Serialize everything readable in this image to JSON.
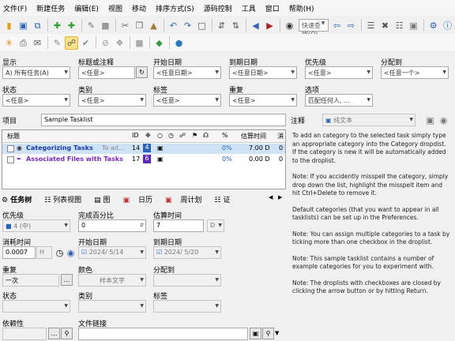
{
  "menu": [
    "文件(F)",
    "新建任务",
    "编辑(E)",
    "视图",
    "移动",
    "排序方式(S)",
    "源码控制",
    "工具",
    "窗口",
    "帮助(H)"
  ],
  "toolbar": {
    "quickfind_placeholder": "快速查找(Q)"
  },
  "filters": {
    "show": {
      "label": "显示",
      "value": "A) 所有任务(A)"
    },
    "title_comment": {
      "label": "标题或注释",
      "value": "<任意>"
    },
    "start_date": {
      "label": "开始日期",
      "value": "<任意日期>"
    },
    "due_date": {
      "label": "到期日期",
      "value": "<任意日期>"
    },
    "priority": {
      "label": "优先级",
      "value": "<任意>"
    },
    "allocated_to": {
      "label": "分配到",
      "value": "<任意一个>"
    },
    "status": {
      "label": "状态",
      "value": "<任意>"
    },
    "category": {
      "label": "类别",
      "value": "<任意>"
    },
    "tag": {
      "label": "标签",
      "value": "<任意>"
    },
    "recurrence": {
      "label": "重复",
      "value": "<任意>"
    },
    "options": {
      "label": "选项",
      "value": "匹配任何人, ..."
    }
  },
  "project": {
    "label": "项目",
    "value": "Sample Tasklist"
  },
  "notes": {
    "label": "注释",
    "format": "纯文本"
  },
  "tasklist": {
    "headers": {
      "title": "标题",
      "id": "ID",
      "percent": "%",
      "estimate": "估算时间",
      "extra": "消"
    },
    "rows": [
      {
        "title": "Categorizing Tasks",
        "comment": "To ad...",
        "id": "14",
        "pri": "4",
        "percent": "0%",
        "estimate": "7.00 D",
        "extra": "0"
      },
      {
        "title": "Associated Files with Tasks",
        "comment": "",
        "id": "17",
        "pri": "6",
        "percent": "0%",
        "estimate": "0.00 D",
        "extra": "0"
      }
    ]
  },
  "bottom_tabs": [
    "任务树",
    "列表视图",
    "图",
    "日历",
    "周计划",
    "证"
  ],
  "editor": {
    "priority": {
      "label": "优先级",
      "value": "4 (中)"
    },
    "percent_done": {
      "label": "完成百分比",
      "value": "0"
    },
    "estimate": {
      "label": "估算时间",
      "value": "7",
      "unit": "D"
    },
    "time_spent": {
      "label": "消耗时间",
      "value": "0.0007",
      "unit": "H"
    },
    "start_date": {
      "label": "开始日期",
      "value": "2024/ 5/14"
    },
    "due_date": {
      "label": "到期日期",
      "value": "2024/ 5/20"
    },
    "recurrence": {
      "label": "重复",
      "value": "一次"
    },
    "color": {
      "label": "颜色",
      "value": "样本文字"
    },
    "allocated_to": {
      "label": "分配到",
      "value": ""
    },
    "status": {
      "label": "状态",
      "value": ""
    },
    "category": {
      "label": "类别",
      "value": ""
    },
    "tag": {
      "label": "标签",
      "value": ""
    },
    "depends": {
      "label": "依赖性",
      "value": ""
    },
    "file_link": {
      "label": "文件链接",
      "value": ""
    }
  },
  "notes_text": [
    "To add an category to the selected task simply type an appropriate category into the Category dropdist. If the category is new it will be automatically added to the droplist.",
    "Note: If you accidently misspell the category, simply drop down the list, highlight the misspelt item and hit Ctrl+Delete to remove it.",
    "Default categories (that you want to appear in all tasklists) can be set up in the Preferences.",
    "Note: You can assign multiple categories to a task by ticking more than one checkbox in the droplist.",
    "Note: This sample tasklist contains a number of example categories for you to experiment with.",
    "Note: The droplists with checkboxes are closed by clicking the arrow button or by hitting Return."
  ]
}
